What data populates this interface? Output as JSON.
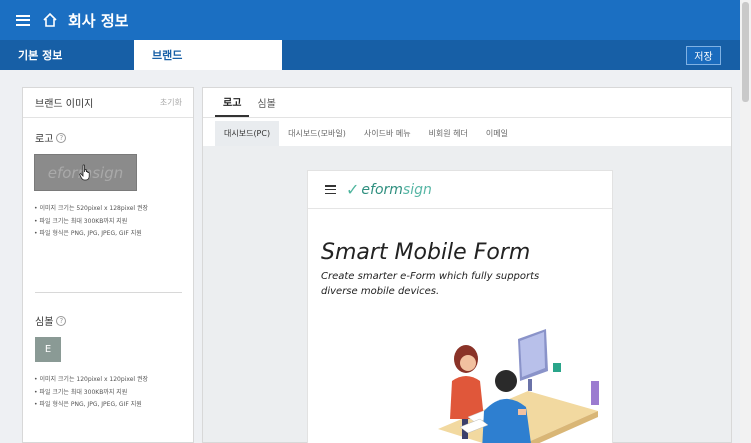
{
  "header": {
    "title": "회사 정보"
  },
  "tabs": {
    "basic": "기본 정보",
    "brand": "브랜드"
  },
  "actions": {
    "save": "저장"
  },
  "brand_image": {
    "title": "브랜드 이미지",
    "reset": "초기화",
    "logo": {
      "label": "로고",
      "notes": [
        "• 이미지 크기는 520pixel x 128pixel 권장",
        "• 파일 크기는 최대 300KB까지 지원",
        "• 파일 형식은 PNG, JPG, JPEG, GIF 지원"
      ]
    },
    "symbol": {
      "label": "심볼",
      "letter": "E",
      "notes": [
        "• 이미지 크기는 120pixel x 120pixel 권장",
        "• 파일 크기는 최대 300KB까지 지원",
        "• 파일 형식은 PNG, JPG, JPEG, GIF 지원"
      ]
    }
  },
  "preview": {
    "tabs": [
      "로고",
      "심볼"
    ],
    "subtabs": [
      "대시보드(PC)",
      "대시보드(모바일)",
      "사이드바 메뉴",
      "비회원 헤더",
      "이메일"
    ],
    "logo_text_e": "eform",
    "logo_text_sign": "sign",
    "hero_title": "Smart Mobile Form",
    "hero_subtitle": "Create smarter e-Form which fully supports diverse mobile devices."
  }
}
